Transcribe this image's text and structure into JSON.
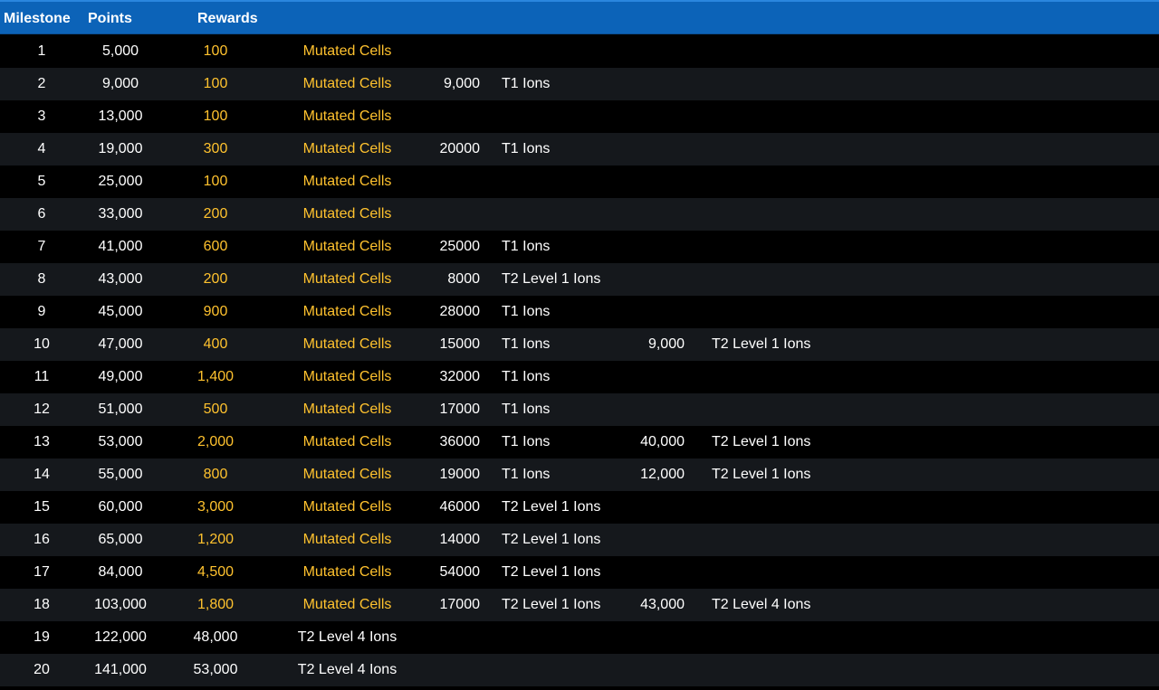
{
  "colors": {
    "header_bg": "#0c63b8",
    "accent_gold": "#ffc22e",
    "text": "#ffffff",
    "row_even": "#15181c",
    "row_odd": "#000000"
  },
  "header": {
    "milestone": "Milestone",
    "points": "Points",
    "rewards": "Rewards"
  },
  "rows": [
    {
      "milestone": "1",
      "points": "5,000",
      "r1_amount": "100",
      "r1_name": "Mutated Cells",
      "r2_amount": "",
      "r2_name": "",
      "r3_amount": "",
      "r3_name": ""
    },
    {
      "milestone": "2",
      "points": "9,000",
      "r1_amount": "100",
      "r1_name": "Mutated Cells",
      "r2_amount": "9,000",
      "r2_name": "T1 Ions",
      "r3_amount": "",
      "r3_name": ""
    },
    {
      "milestone": "3",
      "points": "13,000",
      "r1_amount": "100",
      "r1_name": "Mutated Cells",
      "r2_amount": "",
      "r2_name": "",
      "r3_amount": "",
      "r3_name": ""
    },
    {
      "milestone": "4",
      "points": "19,000",
      "r1_amount": "300",
      "r1_name": "Mutated Cells",
      "r2_amount": "20000",
      "r2_name": "T1 Ions",
      "r3_amount": "",
      "r3_name": ""
    },
    {
      "milestone": "5",
      "points": "25,000",
      "r1_amount": "100",
      "r1_name": "Mutated Cells",
      "r2_amount": "",
      "r2_name": "",
      "r3_amount": "",
      "r3_name": ""
    },
    {
      "milestone": "6",
      "points": "33,000",
      "r1_amount": "200",
      "r1_name": "Mutated Cells",
      "r2_amount": "",
      "r2_name": "",
      "r3_amount": "",
      "r3_name": ""
    },
    {
      "milestone": "7",
      "points": "41,000",
      "r1_amount": "600",
      "r1_name": "Mutated Cells",
      "r2_amount": "25000",
      "r2_name": "T1 Ions",
      "r3_amount": "",
      "r3_name": ""
    },
    {
      "milestone": "8",
      "points": "43,000",
      "r1_amount": "200",
      "r1_name": "Mutated Cells",
      "r2_amount": "8000",
      "r2_name": "T2 Level 1 Ions",
      "r3_amount": "",
      "r3_name": ""
    },
    {
      "milestone": "9",
      "points": "45,000",
      "r1_amount": "900",
      "r1_name": "Mutated Cells",
      "r2_amount": "28000",
      "r2_name": "T1 Ions",
      "r3_amount": "",
      "r3_name": ""
    },
    {
      "milestone": "10",
      "points": "47,000",
      "r1_amount": "400",
      "r1_name": "Mutated Cells",
      "r2_amount": "15000",
      "r2_name": "T1 Ions",
      "r3_amount": "9,000",
      "r3_name": "T2 Level 1 Ions"
    },
    {
      "milestone": "11",
      "points": "49,000",
      "r1_amount": "1,400",
      "r1_name": "Mutated Cells",
      "r2_amount": "32000",
      "r2_name": "T1 Ions",
      "r3_amount": "",
      "r3_name": ""
    },
    {
      "milestone": "12",
      "points": "51,000",
      "r1_amount": "500",
      "r1_name": "Mutated Cells",
      "r2_amount": "17000",
      "r2_name": "T1 Ions",
      "r3_amount": "",
      "r3_name": ""
    },
    {
      "milestone": "13",
      "points": "53,000",
      "r1_amount": "2,000",
      "r1_name": "Mutated Cells",
      "r2_amount": "36000",
      "r2_name": "T1 Ions",
      "r3_amount": "40,000",
      "r3_name": "T2 Level 1 Ions"
    },
    {
      "milestone": "14",
      "points": "55,000",
      "r1_amount": "800",
      "r1_name": "Mutated Cells",
      "r2_amount": "19000",
      "r2_name": "T1 Ions",
      "r3_amount": "12,000",
      "r3_name": "T2 Level 1 Ions"
    },
    {
      "milestone": "15",
      "points": "60,000",
      "r1_amount": "3,000",
      "r1_name": "Mutated Cells",
      "r2_amount": "46000",
      "r2_name": "T2 Level 1 Ions",
      "r3_amount": "",
      "r3_name": ""
    },
    {
      "milestone": "16",
      "points": "65,000",
      "r1_amount": "1,200",
      "r1_name": "Mutated Cells",
      "r2_amount": "14000",
      "r2_name": "T2 Level 1 Ions",
      "r3_amount": "",
      "r3_name": ""
    },
    {
      "milestone": "17",
      "points": "84,000",
      "r1_amount": "4,500",
      "r1_name": "Mutated Cells",
      "r2_amount": "54000",
      "r2_name": "T2 Level 1 Ions",
      "r3_amount": "",
      "r3_name": ""
    },
    {
      "milestone": "18",
      "points": "103,000",
      "r1_amount": "1,800",
      "r1_name": "Mutated Cells",
      "r2_amount": "17000",
      "r2_name": "T2 Level 1 Ions",
      "r3_amount": "43,000",
      "r3_name": "T2 Level 4 Ions"
    },
    {
      "milestone": "19",
      "points": "122,000",
      "r1_amount": "48,000",
      "r1_name": "T2 Level 4 Ions",
      "r2_amount": "",
      "r2_name": "",
      "r3_amount": "",
      "r3_name": ""
    },
    {
      "milestone": "20",
      "points": "141,000",
      "r1_amount": "53,000",
      "r1_name": "T2 Level 4 Ions",
      "r2_amount": "",
      "r2_name": "",
      "r3_amount": "",
      "r3_name": ""
    }
  ]
}
